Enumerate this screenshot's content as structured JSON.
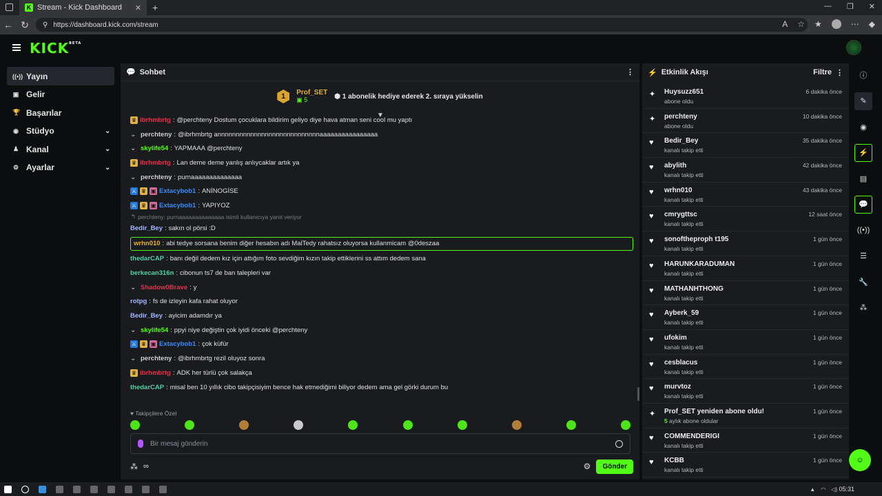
{
  "browser": {
    "tab_title": "Stream - Kick Dashboard",
    "url": "https://dashboard.kick.com/stream"
  },
  "kick": {
    "logo": "KICK",
    "beta": "BETA"
  },
  "sidebar": {
    "items": [
      {
        "label": "Yayın",
        "icon": "broadcast-icon",
        "active": true
      },
      {
        "label": "Gelir",
        "icon": "revenue-icon"
      },
      {
        "label": "Başarılar",
        "icon": "trophy-icon"
      },
      {
        "label": "Stüdyo",
        "icon": "studio-icon",
        "expandable": true
      },
      {
        "label": "Kanal",
        "icon": "channel-icon",
        "expandable": true
      },
      {
        "label": "Ayarlar",
        "icon": "settings-icon",
        "expandable": true
      }
    ]
  },
  "chat": {
    "title": "Sohbet",
    "pinned": {
      "rank": "1",
      "user": "Prof_SET",
      "count": "5",
      "message": "1 abonelik hediye ederek 2. sıraya yükselin"
    },
    "messages": [
      {
        "user": "ibrhmbrtg",
        "color": "#e0344b",
        "badges": [
          "crown"
        ],
        "text": "@perchteny Dostum çocuklara bildirim geliyo diye hava atman seni cool mu yaptı"
      },
      {
        "user": "perchteny",
        "color": "#d0d0d0",
        "badges": [
          "chev"
        ],
        "text": "@ibrhmbrtg annnnnnnnnnnnnnnnnnnnnnnnnnnnaaaaaaaaaaaaaaaa"
      },
      {
        "user": "skylife54",
        "color": "#53fc18",
        "badges": [
          "chev"
        ],
        "text": "YAPMAAA @perchteny"
      },
      {
        "user": "ibrhmbrtg",
        "color": "#e0344b",
        "badges": [
          "crown"
        ],
        "text": "Lan deme deme yanlış anlıycaklar artık ya"
      },
      {
        "user": "perchteny",
        "color": "#d0d0d0",
        "badges": [
          "chev"
        ],
        "text": "purnaaaaaaaaaaaaaa"
      },
      {
        "user": "Extacybob1",
        "color": "#3b8cf0",
        "badges": [
          "mod",
          "crown",
          "gift"
        ],
        "text": "ANİNOGİSE"
      },
      {
        "user": "Extacybob1",
        "color": "#3b8cf0",
        "badges": [
          "mod",
          "crown",
          "gift"
        ],
        "text": "YAPIYOZ"
      },
      {
        "type": "reply",
        "text": "perchteny: purnaaaaaaaaaaaaaa isimli kullanıcıya yanıt veriyor"
      },
      {
        "user": "Bedir_Bey",
        "color": "#a3b7ff",
        "badges": [],
        "text": "sakın ol pörsi :D"
      },
      {
        "user": "wrhn010",
        "color": "#e3b13d",
        "badges": [],
        "text": "abi tedye sorsana benim diğer hesabın adı MalTedy rahatsız oluyorsa kullanmicam @0deszaa",
        "highlight": true
      },
      {
        "user": "thedarCAP",
        "color": "#4fd1a0",
        "badges": [],
        "text": "banı değil dedem kız için attığım foto sevdiğim kızın takip ettiklerini ss attım dedem sana"
      },
      {
        "user": "berkecan316n",
        "color": "#4fd1a0",
        "badges": [],
        "text": "cibonun ts7 de ban talepleri var"
      },
      {
        "user": "Shadow0Brave",
        "color": "#e0344b",
        "badges": [
          "chev"
        ],
        "text": "y"
      },
      {
        "user": "rotpg",
        "color": "#a3b7ff",
        "badges": [],
        "text": "fs de izleyin kafa rahat oluyor"
      },
      {
        "user": "Bedir_Bey",
        "color": "#a3b7ff",
        "badges": [],
        "text": "ayicim adamdır ya"
      },
      {
        "user": "skylife54",
        "color": "#53fc18",
        "badges": [
          "chev"
        ],
        "text": "ppyi niye değiştin çok iyidi önceki @perchteny"
      },
      {
        "user": "Extacybob1",
        "color": "#3b8cf0",
        "badges": [
          "mod",
          "crown",
          "gift"
        ],
        "text": "çok küfür"
      },
      {
        "user": "perchteny",
        "color": "#d0d0d0",
        "badges": [
          "chev"
        ],
        "text": "@ibrhmbrtg rezil oluyoz sonra"
      },
      {
        "user": "ibrhmbrtg",
        "color": "#e0344b",
        "badges": [
          "crown"
        ],
        "text": "ADK her türlü çok salakça"
      },
      {
        "user": "thedarCAP",
        "color": "#4fd1a0",
        "badges": [],
        "text": "misal ben 10 yıllık cibo takipçisiyim bence hak etmediğimi biliyor dedem ama gel görki durum bu"
      }
    ],
    "followers_only": "Takipçilere Özel",
    "input_placeholder": "Bir mesaj gönderin",
    "send_label": "Gönder"
  },
  "feed": {
    "title": "Etkinlik Akışı",
    "filter_label": "Filtre",
    "items": [
      {
        "icon": "sparkle-icon",
        "name": "Huysuzz651",
        "desc": "abone oldu",
        "time": "6 dakika önce"
      },
      {
        "icon": "sparkle-icon",
        "name": "perchteny",
        "desc": "abone oldu",
        "time": "10 dakika önce"
      },
      {
        "icon": "heart-icon",
        "name": "Bedir_Bey",
        "desc": "kanalı takip etti",
        "time": "35 dakika önce"
      },
      {
        "icon": "heart-icon",
        "name": "abylith",
        "desc": "kanalı takip etti",
        "time": "42 dakika önce"
      },
      {
        "icon": "heart-icon",
        "name": "wrhn010",
        "desc": "kanalı takip etti",
        "time": "43 dakika önce"
      },
      {
        "icon": "heart-icon",
        "name": "cmrygttsc",
        "desc": "kanalı takip etti",
        "time": "12 saat önce"
      },
      {
        "icon": "heart-icon",
        "name": "sonoftheproph t195",
        "desc": "kanalı takip etti",
        "time": "1 gün önce"
      },
      {
        "icon": "heart-icon",
        "name": "HARUNKARADUMAN",
        "desc": "kanalı takip etti",
        "time": "1 gün önce"
      },
      {
        "icon": "heart-icon",
        "name": "MATHANHTHONG",
        "desc": "kanalı takip etti",
        "time": "1 gün önce"
      },
      {
        "icon": "heart-icon",
        "name": "Ayberk_59",
        "desc": "kanalı takip etti",
        "time": "1 gün önce"
      },
      {
        "icon": "heart-icon",
        "name": "ufokim",
        "desc": "kanalı takip etti",
        "time": "1 gün önce"
      },
      {
        "icon": "heart-icon",
        "name": "cesblacus",
        "desc": "kanalı takip etti",
        "time": "1 gün önce"
      },
      {
        "icon": "heart-icon",
        "name": "murvtoz",
        "desc": "kanalı takip etti",
        "time": "1 gün önce"
      },
      {
        "icon": "sparkle-icon",
        "name": "Prof_SET yeniden abone oldu!",
        "desc_strong": "5",
        "desc": "aylık abone oldular",
        "time": "1 gün önce"
      },
      {
        "icon": "heart-icon",
        "name": "COMMENDERIGI",
        "desc": "kanalı takip etti",
        "time": "1 gün önce"
      },
      {
        "icon": "heart-icon",
        "name": "KCBB",
        "desc": "kanalı takip etti",
        "time": "1 gün önce"
      }
    ]
  },
  "taskbar": {
    "clock": "05:31"
  },
  "colors": {
    "accent": "#53fc18",
    "panel": "#191b1f",
    "bg": "#0b0e0f"
  }
}
